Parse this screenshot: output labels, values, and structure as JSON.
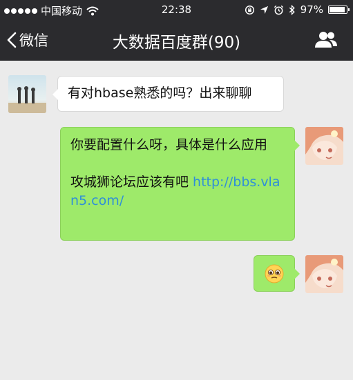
{
  "status_bar": {
    "carrier": "中国移动",
    "time": "22:38",
    "battery": "97%",
    "battery_level": 0.97,
    "icons": [
      "signal-dots-icon",
      "wifi-icon",
      "rotation-lock-icon",
      "location-icon",
      "alarm-icon",
      "bluetooth-icon",
      "battery-icon"
    ]
  },
  "nav": {
    "back_label": "微信",
    "title": "大数据百度群(90)",
    "back_icon": "chevron-left-icon",
    "group_icon": "group-members-icon"
  },
  "messages": [
    {
      "direction": "incoming",
      "text": "有对hbase熟悉的吗？出来聊聊"
    },
    {
      "direction": "outgoing",
      "line1": "你要配置什么呀，具体是什么应用",
      "line2": "攻城狮论坛应该有吧 ",
      "link": "http://bbs.vlan5.com/"
    },
    {
      "direction": "outgoing",
      "emoji": "🥺"
    }
  ],
  "colors": {
    "bar_background": "#2b2b2e",
    "chat_background": "#ebebeb",
    "outgoing_bubble": "#9eea6a",
    "incoming_bubble": "#ffffff",
    "link": "#2f8fd8"
  }
}
